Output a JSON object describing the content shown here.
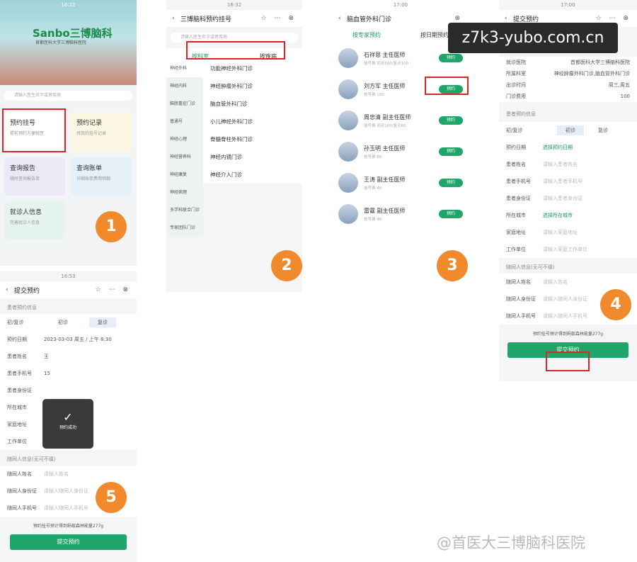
{
  "watermark": "z7k3-yubo.com.cn",
  "footer": "@首医大三博脑科医院",
  "p1": {
    "time": "16:22",
    "logo": "Sanbo三博脑科",
    "sub": "首都医科大学三博脑科医院",
    "search": "请输入医生名字或者疾病",
    "cards": [
      {
        "t": "预约挂号",
        "d": "提前预约方便就医"
      },
      {
        "t": "预约记录",
        "d": "找我的挂号记录"
      },
      {
        "t": "查询报告",
        "d": "随时查询报告单"
      },
      {
        "t": "查询账单",
        "d": "详细账单费用明细"
      },
      {
        "t": "就诊人信息",
        "d": "完善就诊人信息"
      }
    ],
    "num": "1"
  },
  "p2": {
    "time": "16:32",
    "title": "三博脑科预约挂号",
    "search": "请输入医生名字或者疾病",
    "tabs": [
      "按科室",
      "按疾病"
    ],
    "side": [
      "神经外科",
      "神经内科",
      "脑肠重症门诊",
      "普通号",
      "神经心理",
      "神经营养科",
      "神经康复",
      "神经病理",
      "多学科联合门诊",
      "专家团队门诊"
    ],
    "list": [
      "功能神经外科门诊",
      "神经肿瘤外科门诊",
      "脑血管外科门诊",
      "小儿神经外科门诊",
      "脊髓脊柱外科门诊",
      "神经内镜门诊",
      "神经介入门诊"
    ],
    "num": "2"
  },
  "p3": {
    "time": "17:00",
    "title": "脑血管外科门诊",
    "tabs": [
      "按专家预约",
      "按日期预约"
    ],
    "book": "预约",
    "docs": [
      {
        "n": "石祥恩 主任医师",
        "s": "挂号费 初诊500/复诊100"
      },
      {
        "n": "刘方军 主任医师",
        "s": "挂号费 100"
      },
      {
        "n": "周忠清 副主任医师",
        "s": "挂号费 初诊100/复诊60"
      },
      {
        "n": "孙玉明 主任医师",
        "s": "挂号费 80"
      },
      {
        "n": "王涛 副主任医师",
        "s": "挂号费 40"
      },
      {
        "n": "雷霆 副主任医师",
        "s": "挂号费 40"
      }
    ],
    "num": "3"
  },
  "p4": {
    "time": "17:00",
    "title": "提交预约",
    "info": [
      [
        "就诊医院",
        "首都医科大学三博脑科医院"
      ],
      [
        "所属科室",
        "神经肿瘤外科门诊,脑血管外科门诊"
      ],
      [
        "出诊时间",
        "周三,周五"
      ],
      [
        "门诊费用",
        "100"
      ]
    ],
    "sec": "患者预约信息",
    "visit": [
      "初/复诊",
      "初诊",
      "复诊"
    ],
    "rows": [
      [
        "预约日期",
        "选择预约日期"
      ],
      [
        "患者姓名",
        "请输入患者姓名"
      ],
      [
        "患者手机号",
        "请输入患者手机号"
      ],
      [
        "患者身份证",
        "请输入患者身份证"
      ],
      [
        "所在城市",
        "选择所在城市"
      ],
      [
        "家庭地址",
        "请输入家庭地址"
      ],
      [
        "工作单位",
        "请输入家庭工作单位"
      ]
    ],
    "comp": "随同人信息(无可不填)",
    "crows": [
      [
        "随同人姓名",
        "请输入姓名"
      ],
      [
        "随同人身份证",
        "请输入随同人身份证"
      ],
      [
        "随同人手机号",
        "请输入随同人手机号"
      ]
    ],
    "note": "预约挂号预计得到蚂蚁森林能量277g",
    "submit": "提交预约",
    "num": "4"
  },
  "p5": {
    "time": "16:53",
    "title": "提交预约",
    "sec": "患者预约信息",
    "visit": [
      "初/复诊",
      "初诊",
      "复诊"
    ],
    "rows": [
      [
        "预约日期",
        "2023-03-03 周五 / 上午 8:30"
      ],
      [
        "患者姓名",
        "王"
      ],
      [
        "患者手机号",
        "15"
      ],
      [
        "患者身份证",
        ""
      ],
      [
        "所在城市",
        ""
      ],
      [
        "家庭地址",
        ""
      ],
      [
        "工作单位",
        ""
      ]
    ],
    "comp": "随同人信息(无可不填)",
    "crows": [
      [
        "随同人姓名",
        "请输入姓名"
      ],
      [
        "随同人身份证",
        "请输入随同人身份证"
      ],
      [
        "随同人手机号",
        "请输入随同人手机号"
      ]
    ],
    "toast": "预约成功",
    "note": "预约挂号预计得到蚂蚁森林能量277g",
    "submit": "提交预约",
    "num": "5"
  }
}
